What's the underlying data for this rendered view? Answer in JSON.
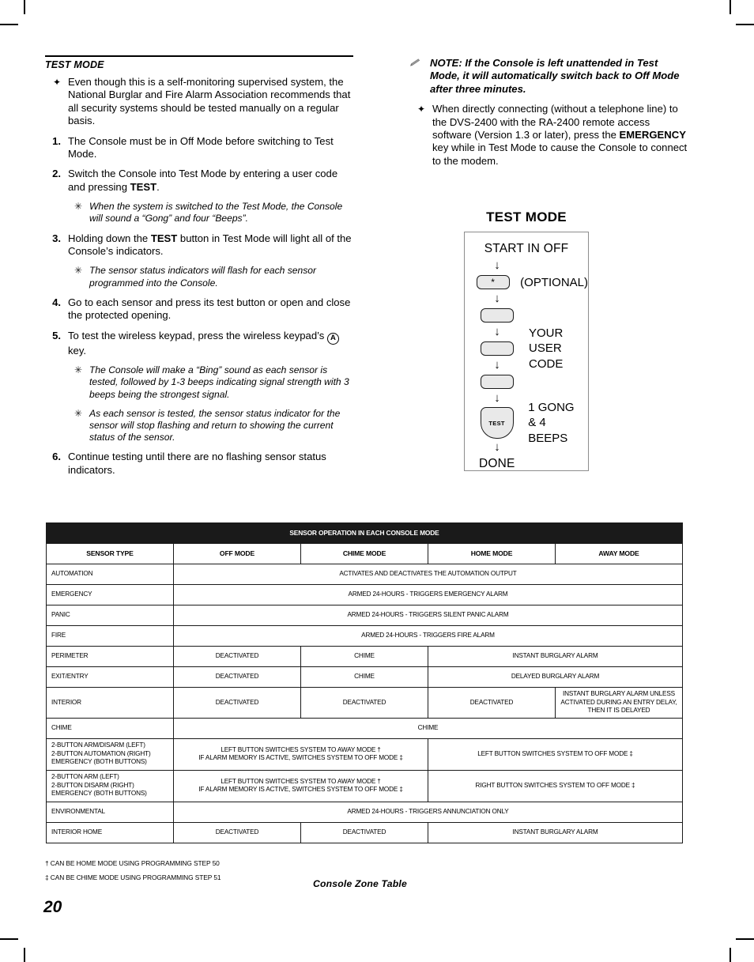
{
  "left_column": {
    "section_title": "TEST MODE",
    "items": [
      {
        "marker": "✦",
        "type": "bullet",
        "text": "Even though this is a self-monitoring supervised system, the National Burglar and Fire Alarm Association recommends that all security systems should be tested manually on a regular basis."
      },
      {
        "marker": "1.",
        "type": "numbered",
        "text": "The Console must be in Off Mode before switching to Test Mode."
      },
      {
        "marker": "2.",
        "type": "numbered",
        "text_pre": "Switch the Console into Test Mode by entering a user code and pressing ",
        "text_bold": "TEST",
        "text_post": "."
      },
      {
        "marker": "✳",
        "type": "star",
        "text": "When the system is switched to the Test Mode, the Console will sound a “Gong” and four “Beeps”."
      },
      {
        "marker": "3.",
        "type": "numbered",
        "text_pre": "Holding down the ",
        "text_bold": "TEST",
        "text_post": " button in Test Mode will light all of the Console’s indicators."
      },
      {
        "marker": "✳",
        "type": "star",
        "text": "The sensor status indicators will flash for each sensor programmed into the Console."
      },
      {
        "marker": "4.",
        "type": "numbered",
        "text": "Go to each sensor and press its test button or open and close the protected opening."
      },
      {
        "marker": "5.",
        "type": "numbered",
        "text_pre": "To test the wireless keypad, press the wireless keypad’s ",
        "icon": "circled-a-icon",
        "icon_label": "A",
        "text_post": " key."
      },
      {
        "marker": "✳",
        "type": "star",
        "text": "The Console will make a “Bing” sound as each sensor is tested, followed by 1-3 beeps indicating signal strength with 3 beeps being the strongest signal."
      },
      {
        "marker": "✳",
        "type": "star",
        "text": "As each sensor is tested, the sensor status indicator for the sensor will stop flashing and return to showing the current status of the sensor."
      },
      {
        "marker": "6.",
        "type": "numbered",
        "text": "Continue testing until there are no flashing sensor status indicators."
      }
    ]
  },
  "right_column": {
    "note": {
      "marker_icon": "pencil-icon",
      "text": "NOTE: If the Console is left unattended in Test Mode, it will automatically switch back to Off Mode after three minutes."
    },
    "bullet": {
      "marker": "✦",
      "text_pre": "When directly connecting (without a telephone line) to the DVS-2400 with the RA-2400 remote access software (Version 1.3 or later), press the ",
      "text_bold": "EMERGENCY",
      "text_post": " key while in Test Mode to cause the Console to connect to the modem."
    }
  },
  "flow_diagram": {
    "title": "TEST MODE",
    "start_label": "START IN OFF",
    "steps": [
      {
        "key_label": "*",
        "key_type": "rounded",
        "side_label": "(OPTIONAL)"
      },
      {
        "key_label": "",
        "key_type": "rounded",
        "side_label": ""
      },
      {
        "key_label": "",
        "key_type": "rounded",
        "side_label_lines": [
          "YOUR",
          "USER",
          "CODE"
        ]
      },
      {
        "key_label": "",
        "key_type": "rounded",
        "side_label": ""
      },
      {
        "key_label": "TEST",
        "key_type": "test",
        "side_label_lines": [
          "1 GONG",
          "& 4 BEEPS"
        ]
      }
    ],
    "end_label": "DONE",
    "arrow_glyph": "↓"
  },
  "table": {
    "band_title": "SENSOR OPERATION IN EACH CONSOLE MODE",
    "columns": [
      "SENSOR TYPE",
      "OFF MODE",
      "CHIME MODE",
      "HOME MODE",
      "AWAY MODE"
    ],
    "rows": [
      {
        "name": "AUTOMATION",
        "cells": [
          {
            "text": "ACTIVATES AND DEACTIVATES THE AUTOMATION OUTPUT",
            "span": 4
          }
        ]
      },
      {
        "name": "EMERGENCY",
        "cells": [
          {
            "text": "ARMED 24-HOURS - TRIGGERS EMERGENCY ALARM",
            "span": 4
          }
        ]
      },
      {
        "name": "PANIC",
        "cells": [
          {
            "text": "ARMED 24-HOURS - TRIGGERS SILENT PANIC ALARM",
            "span": 4
          }
        ]
      },
      {
        "name": "FIRE",
        "cells": [
          {
            "text": "ARMED 24-HOURS - TRIGGERS FIRE ALARM",
            "span": 4
          }
        ]
      },
      {
        "name": "PERIMETER",
        "cells": [
          {
            "text": "DEACTIVATED",
            "span": 1
          },
          {
            "text": "CHIME",
            "span": 1
          },
          {
            "text": "INSTANT BURGLARY ALARM",
            "span": 2
          }
        ]
      },
      {
        "name": "EXIT/ENTRY",
        "cells": [
          {
            "text": "DEACTIVATED",
            "span": 1
          },
          {
            "text": "CHIME",
            "span": 1
          },
          {
            "text": "DELAYED BURGLARY ALARM",
            "span": 2
          }
        ]
      },
      {
        "name": "INTERIOR",
        "tall": true,
        "cells": [
          {
            "text": "DEACTIVATED",
            "span": 1
          },
          {
            "text": "DEACTIVATED",
            "span": 1
          },
          {
            "text": "DEACTIVATED",
            "span": 1
          },
          {
            "text": "INSTANT BURGLARY ALARM UNLESS ACTIVATED DURING AN ENTRY DELAY, THEN IT IS DELAYED",
            "span": 1
          }
        ]
      },
      {
        "name": "CHIME",
        "cells": [
          {
            "text": "CHIME",
            "span": 4
          }
        ]
      },
      {
        "name": "2-BUTTON ARM/DISARM (LEFT)\n2-BUTTON AUTOMATION (RIGHT)\nEMERGENCY (BOTH BUTTONS)",
        "tall2": true,
        "cells": [
          {
            "text": "LEFT BUTTON SWITCHES SYSTEM TO AWAY MODE †\nIF ALARM MEMORY IS ACTIVE, SWITCHES SYSTEM TO OFF MODE ‡",
            "span": 2
          },
          {
            "text": "LEFT BUTTON SWITCHES SYSTEM TO OFF MODE ‡",
            "span": 2
          }
        ]
      },
      {
        "name": "2-BUTTON ARM (LEFT)\n2-BUTTON DISARM (RIGHT)\nEMERGENCY (BOTH BUTTONS)",
        "tall2": true,
        "cells": [
          {
            "text": "LEFT BUTTON SWITCHES SYSTEM TO AWAY MODE †\nIF ALARM MEMORY IS ACTIVE, SWITCHES SYSTEM TO OFF MODE ‡",
            "span": 2
          },
          {
            "text": "RIGHT BUTTON SWITCHES SYSTEM TO OFF MODE ‡",
            "span": 2
          }
        ]
      },
      {
        "name": "ENVIRONMENTAL",
        "cells": [
          {
            "text": "ARMED 24-HOURS - TRIGGERS ANNUNCIATION ONLY",
            "span": 4
          }
        ]
      },
      {
        "name": "INTERIOR HOME",
        "cells": [
          {
            "text": "DEACTIVATED",
            "span": 1
          },
          {
            "text": "DEACTIVATED",
            "span": 1
          },
          {
            "text": "INSTANT BURGLARY ALARM",
            "span": 2
          }
        ]
      }
    ]
  },
  "footnotes": {
    "line1": "† CAN BE HOME MODE USING PROGRAMMING STEP 50",
    "line2": "‡ CAN BE CHIME MODE USING PROGRAMMING STEP 51"
  },
  "caption": "Console Zone Table",
  "page_number": "20"
}
